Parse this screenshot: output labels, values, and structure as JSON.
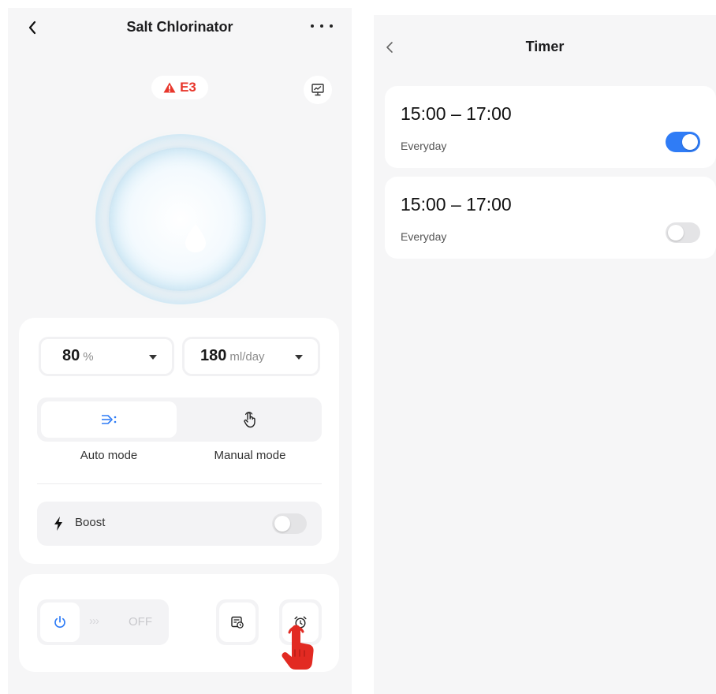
{
  "left": {
    "title": "Salt Chlorinator",
    "error_code": "E3",
    "chlorine_output": {
      "value": "80",
      "unit": "%"
    },
    "dosage": {
      "value": "180",
      "unit": "ml/day"
    },
    "modes": {
      "auto_label": "Auto mode",
      "manual_label": "Manual mode",
      "selected": "auto"
    },
    "boost": {
      "label": "Boost",
      "enabled": false
    },
    "power": {
      "chevrons": "›››",
      "state": "OFF"
    },
    "icons": [
      "back-icon",
      "more-icon",
      "warning-icon",
      "monitor-chart-icon",
      "water-drop-icon",
      "flow-icon",
      "touch-hand-icon",
      "lightning-icon",
      "power-icon",
      "schedule-icon",
      "alarm-clock-icon"
    ]
  },
  "right": {
    "title": "Timer",
    "timers": [
      {
        "range": "15:00 – 17:00",
        "repeat": "Everyday",
        "enabled": true
      },
      {
        "range": "15:00 – 17:00",
        "repeat": "Everyday",
        "enabled": false
      }
    ]
  },
  "colors": {
    "accent": "#2f7cf6",
    "error": "#e8362b",
    "hand": "#e22a22",
    "background": "#f6f6f7"
  }
}
